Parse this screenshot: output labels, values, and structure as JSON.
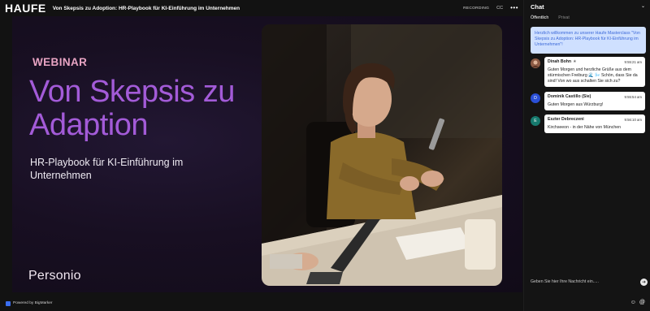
{
  "header": {
    "logo": "HAUFE",
    "title": "Von Skepsis zu Adoption: HR-Playbook für KI-Einführung im Unternehmen",
    "recording": "RECORDING",
    "cc": "CC",
    "more": "•••"
  },
  "slide": {
    "eyebrow": "WEBINAR",
    "headline": "Von Skepsis zu Adaption",
    "subline": "HR-Playbook für KI-Einführung im Unternehmen",
    "brand": "Personio"
  },
  "footer": {
    "powered_by": "Powered by BigMarker"
  },
  "chat": {
    "title": "Chat",
    "tabs": [
      "Öffentlich",
      "Privat"
    ],
    "welcome": "Herzlich willkommen zu unserer Haufe Masterclass \"Von Skepsis zu Adoption: HR-Playbook für KI-Einführung im Unternehmen\"!",
    "messages": [
      {
        "name": "Dinah Bohn",
        "badge": "★",
        "time": "9:55:21 am",
        "text": "Guten Morgen und herzliche Grüße aus dem stürmischen Freiburg 🌊 🌬️ Schön, dass Sie da sind! Von wo aus schalten Sie sich zu?",
        "avatar": "",
        "avatar_color": "#7a4a3a"
      },
      {
        "name": "Dominik Castillo (Sie)",
        "badge": "",
        "time": "9:55:54 am",
        "text": "Guten Morgen aus Würzburg!",
        "avatar": "D",
        "avatar_color": "#2a4fd6"
      },
      {
        "name": "Eszter Debreczeni",
        "badge": "",
        "time": "9:56:10 am",
        "text": "Kirchseeon - in der Nähe von München",
        "avatar": "E",
        "avatar_color": "#167a6e"
      }
    ],
    "input_placeholder": "Geben Sie hier Ihre Nachricht ein.....",
    "send_icon": "➜",
    "emoji_icon": "☺",
    "mention_icon": "@"
  }
}
